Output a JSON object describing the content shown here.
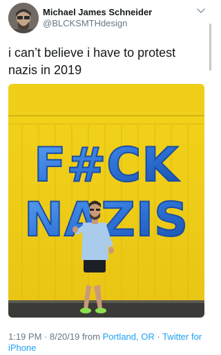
{
  "tweet": {
    "author_name": "Michael James Schneider",
    "author_handle": "@BLCKSMTHdesign",
    "text": "i can’t believe i have to protest nazis in 2019",
    "photo_text_line1": "F#CK",
    "photo_text_line2": "NAZIS",
    "time": "1:19 PM",
    "separator": " · ",
    "date": "8/20/19",
    "from_label": " from ",
    "location": "Portland, OR",
    "source": "Twitter for iPhone"
  },
  "icons": {
    "avatar": "avatar",
    "menu": "chevron-down-icon"
  },
  "colors": {
    "wall": "#f3d31a",
    "balloon": "#2f74d9",
    "link": "#1da1f2",
    "secondary_text": "#657786"
  }
}
